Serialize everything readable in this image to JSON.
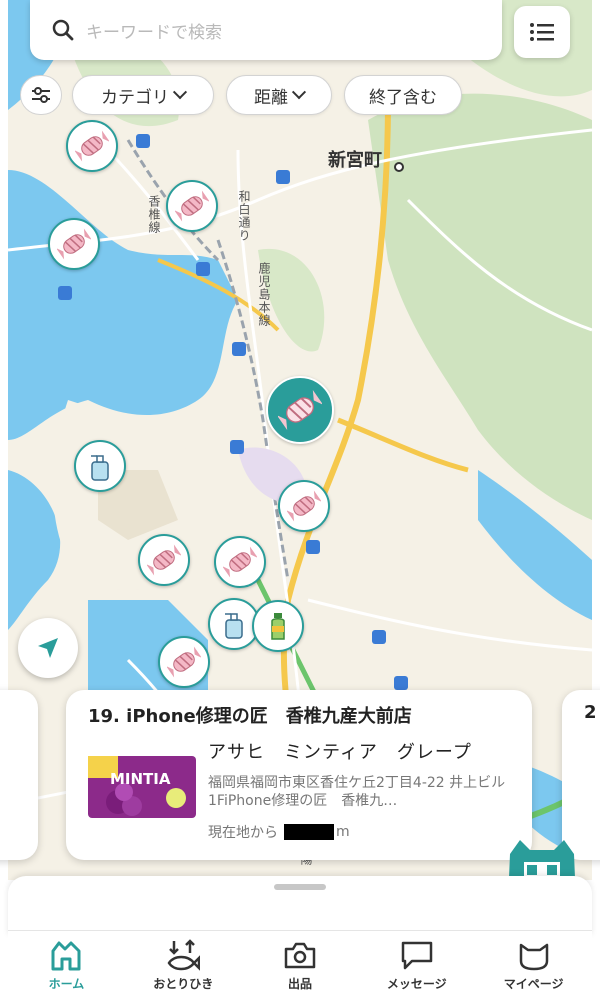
{
  "search": {
    "placeholder": "キーワードで検索"
  },
  "filters": [
    {
      "label": "カテゴリ"
    },
    {
      "label": "距離"
    },
    {
      "label": "終了含む"
    }
  ],
  "map": {
    "place_name": "新宮町",
    "rail_line_1": "鹿児島本線",
    "rail_line_2": "香椎線",
    "road_1": "和白通り",
    "road_2": "山陽"
  },
  "card": {
    "title": "19. iPhone修理の匠　香椎九産大前店",
    "product_name": "アサヒ　ミンティア　グレープ",
    "address": "福岡県福岡市東区香住ケ丘2丁目4-22 井上ビル1FiPhone修理の匠　香椎九…",
    "distance_prefix": "現在地から",
    "distance_unit": "m",
    "next_number": "2",
    "product_image_text": "MINTIA"
  },
  "tabs": [
    {
      "label": "ホーム",
      "icon": "home-icon"
    },
    {
      "label": "おとりひき",
      "icon": "exchange-icon"
    },
    {
      "label": "出品",
      "icon": "camera-icon"
    },
    {
      "label": "メッセージ",
      "icon": "message-icon"
    },
    {
      "label": "マイページ",
      "icon": "cat-icon"
    }
  ],
  "colors": {
    "accent": "#2a9d9a",
    "water": "#7cc8ef",
    "highway": "#f5c84c",
    "green": "#cfe3bf"
  }
}
